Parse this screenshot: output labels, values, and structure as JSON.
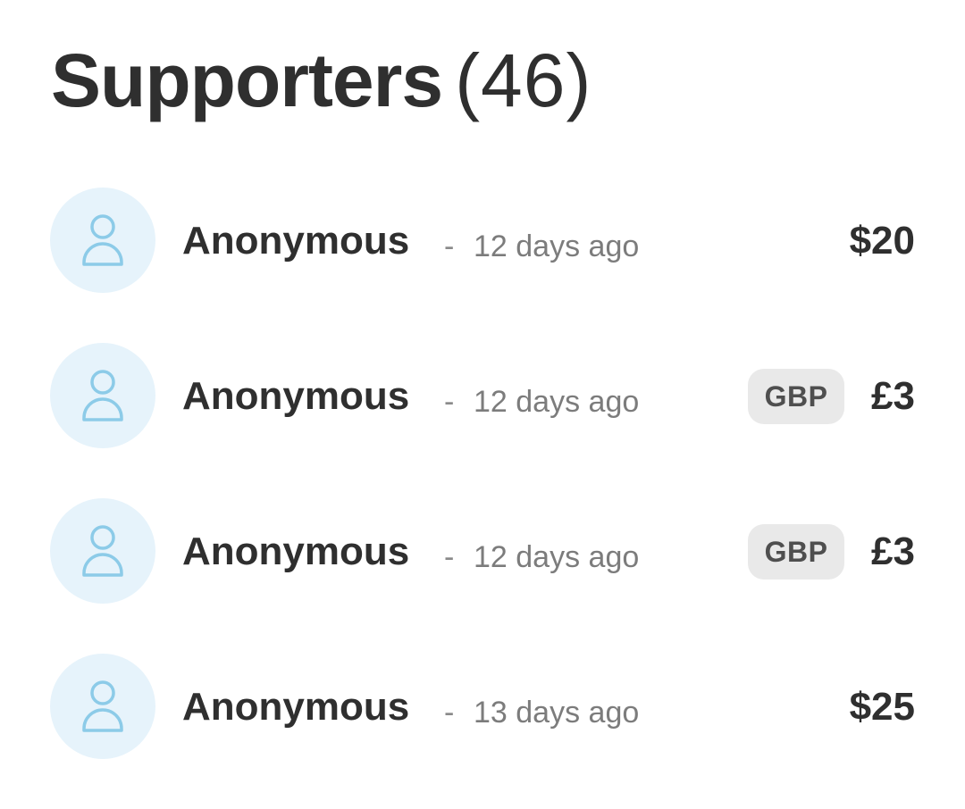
{
  "header": {
    "title": "Supporters",
    "count": "(46)"
  },
  "colors": {
    "avatar_background": "#e6f3fb",
    "avatar_icon": "#8ccbe8",
    "text_primary": "#2f2f2f",
    "text_secondary": "#7c7c7c",
    "badge_background": "#e9e9e9"
  },
  "supporters": [
    {
      "avatar_icon": "person-icon",
      "name": "Anonymous",
      "separator": "-",
      "time": "12 days ago",
      "currency_badge": "",
      "amount": "$20"
    },
    {
      "avatar_icon": "person-icon",
      "name": "Anonymous",
      "separator": "-",
      "time": "12 days ago",
      "currency_badge": "GBP",
      "amount": "£3"
    },
    {
      "avatar_icon": "person-icon",
      "name": "Anonymous",
      "separator": "-",
      "time": "12 days ago",
      "currency_badge": "GBP",
      "amount": "£3"
    },
    {
      "avatar_icon": "person-icon",
      "name": "Anonymous",
      "separator": "-",
      "time": "13 days ago",
      "currency_badge": "",
      "amount": "$25"
    }
  ]
}
